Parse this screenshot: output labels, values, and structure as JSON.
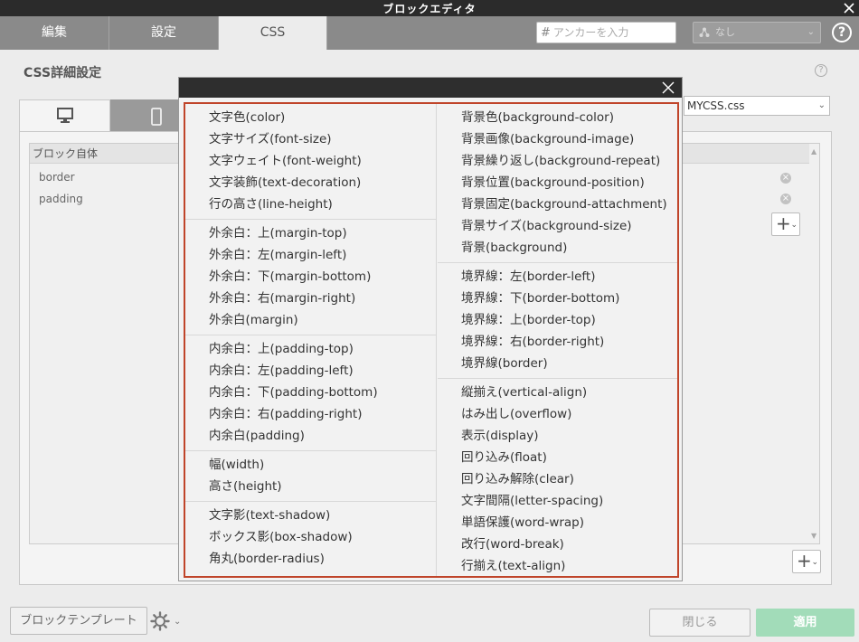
{
  "window": {
    "title": "ブロックエディタ"
  },
  "tabs": [
    {
      "label": "編集"
    },
    {
      "label": "設定"
    },
    {
      "label": "CSS"
    }
  ],
  "anchor": {
    "placeholder": "アンカーを入力"
  },
  "anchor_select": {
    "value": "なし"
  },
  "section_title": "CSS詳細設定",
  "css_file": {
    "value": "MYCSS.css"
  },
  "block": {
    "header": "ブロック自体",
    "properties": [
      "border",
      "padding"
    ]
  },
  "bottom": {
    "template_button": "ブロックテンプレート",
    "close_button": "閉じる",
    "apply_button": "適用"
  },
  "colors": {
    "accent_green": "#a2dcb9",
    "modal_border": "#c0452a",
    "titlebar": "#2b2b2b"
  },
  "modal": {
    "left_groups": [
      [
        "文字色(color)",
        "文字サイズ(font-size)",
        "文字ウェイト(font-weight)",
        "文字装飾(text-decoration)",
        "行の高さ(line-height)"
      ],
      [
        "外余白：上(margin-top)",
        "外余白：左(margin-left)",
        "外余白：下(margin-bottom)",
        "外余白：右(margin-right)",
        "外余白(margin)"
      ],
      [
        "内余白：上(padding-top)",
        "内余白：左(padding-left)",
        "内余白：下(padding-bottom)",
        "内余白：右(padding-right)",
        "内余白(padding)"
      ],
      [
        "幅(width)",
        "高さ(height)"
      ],
      [
        "文字影(text-shadow)",
        "ボックス影(box-shadow)",
        "角丸(border-radius)"
      ]
    ],
    "right_groups": [
      [
        "背景色(background-color)",
        "背景画像(background-image)",
        "背景繰り返し(background-repeat)",
        "背景位置(background-position)",
        "背景固定(background-attachment)",
        "背景サイズ(background-size)",
        "背景(background)"
      ],
      [
        "境界線：左(border-left)",
        "境界線：下(border-bottom)",
        "境界線：上(border-top)",
        "境界線：右(border-right)",
        "境界線(border)"
      ],
      [
        "縦揃え(vertical-align)",
        "はみ出し(overflow)",
        "表示(display)",
        "回り込み(float)",
        "回り込み解除(clear)",
        "文字間隔(letter-spacing)",
        "単語保護(word-wrap)",
        "改行(word-break)",
        "行揃え(text-align)"
      ]
    ]
  }
}
